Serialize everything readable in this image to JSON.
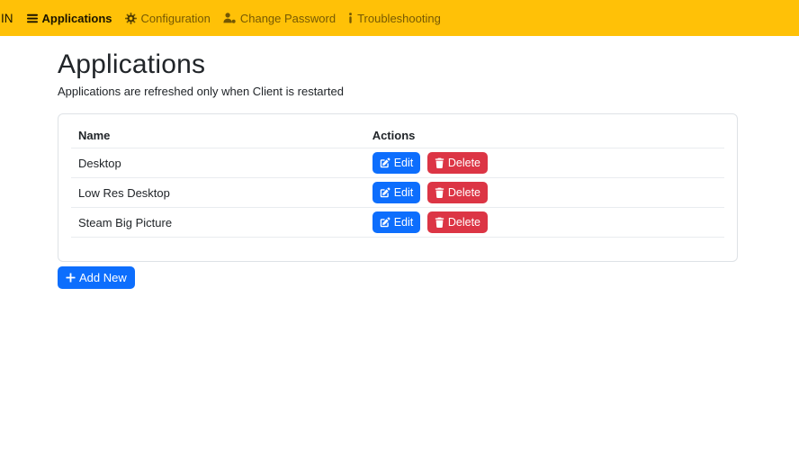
{
  "colors": {
    "navbar_bg": "#ffc107",
    "primary": "#0d6efd",
    "danger": "#dc3545",
    "heading": "#212529",
    "card_border": "#dee2e6",
    "row_border": "#e9ecef"
  },
  "navbar": {
    "brand_fragment": "IN",
    "items": [
      {
        "label": "Applications",
        "icon": "bars-icon",
        "active": true
      },
      {
        "label": "Configuration",
        "icon": "gear-icon",
        "active": false
      },
      {
        "label": "Change Password",
        "icon": "user-icon",
        "active": false
      },
      {
        "label": "Troubleshooting",
        "icon": "info-icon",
        "active": false
      }
    ]
  },
  "page": {
    "title": "Applications",
    "subtitle": "Applications are refreshed only when Client is restarted"
  },
  "table": {
    "headers": [
      "Name",
      "Actions"
    ],
    "rows": [
      {
        "name": "Desktop"
      },
      {
        "name": "Low Res Desktop"
      },
      {
        "name": "Steam Big Picture"
      }
    ],
    "edit_label": "Edit",
    "delete_label": "Delete"
  },
  "add_new_label": "Add New"
}
